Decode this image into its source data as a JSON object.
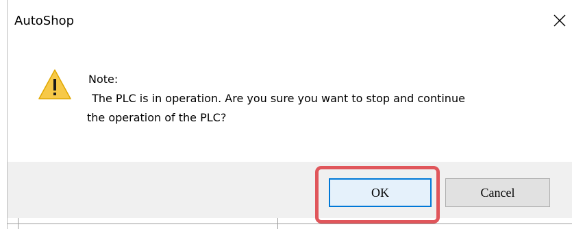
{
  "dialog": {
    "title": "AutoShop",
    "close_icon": "close-icon",
    "icon": "warning-icon",
    "message": {
      "line1": "Note:",
      "line2": " The PLC is in operation. Are you sure you want to stop and continue",
      "line3": "the operation of the PLC?"
    },
    "buttons": {
      "ok_label": "OK",
      "cancel_label": "Cancel"
    }
  },
  "colors": {
    "ok_focus_border": "#0078d7",
    "highlight": "#e0565b",
    "warning_fill": "#f7c948",
    "footer_bg": "#f0f0f0"
  }
}
